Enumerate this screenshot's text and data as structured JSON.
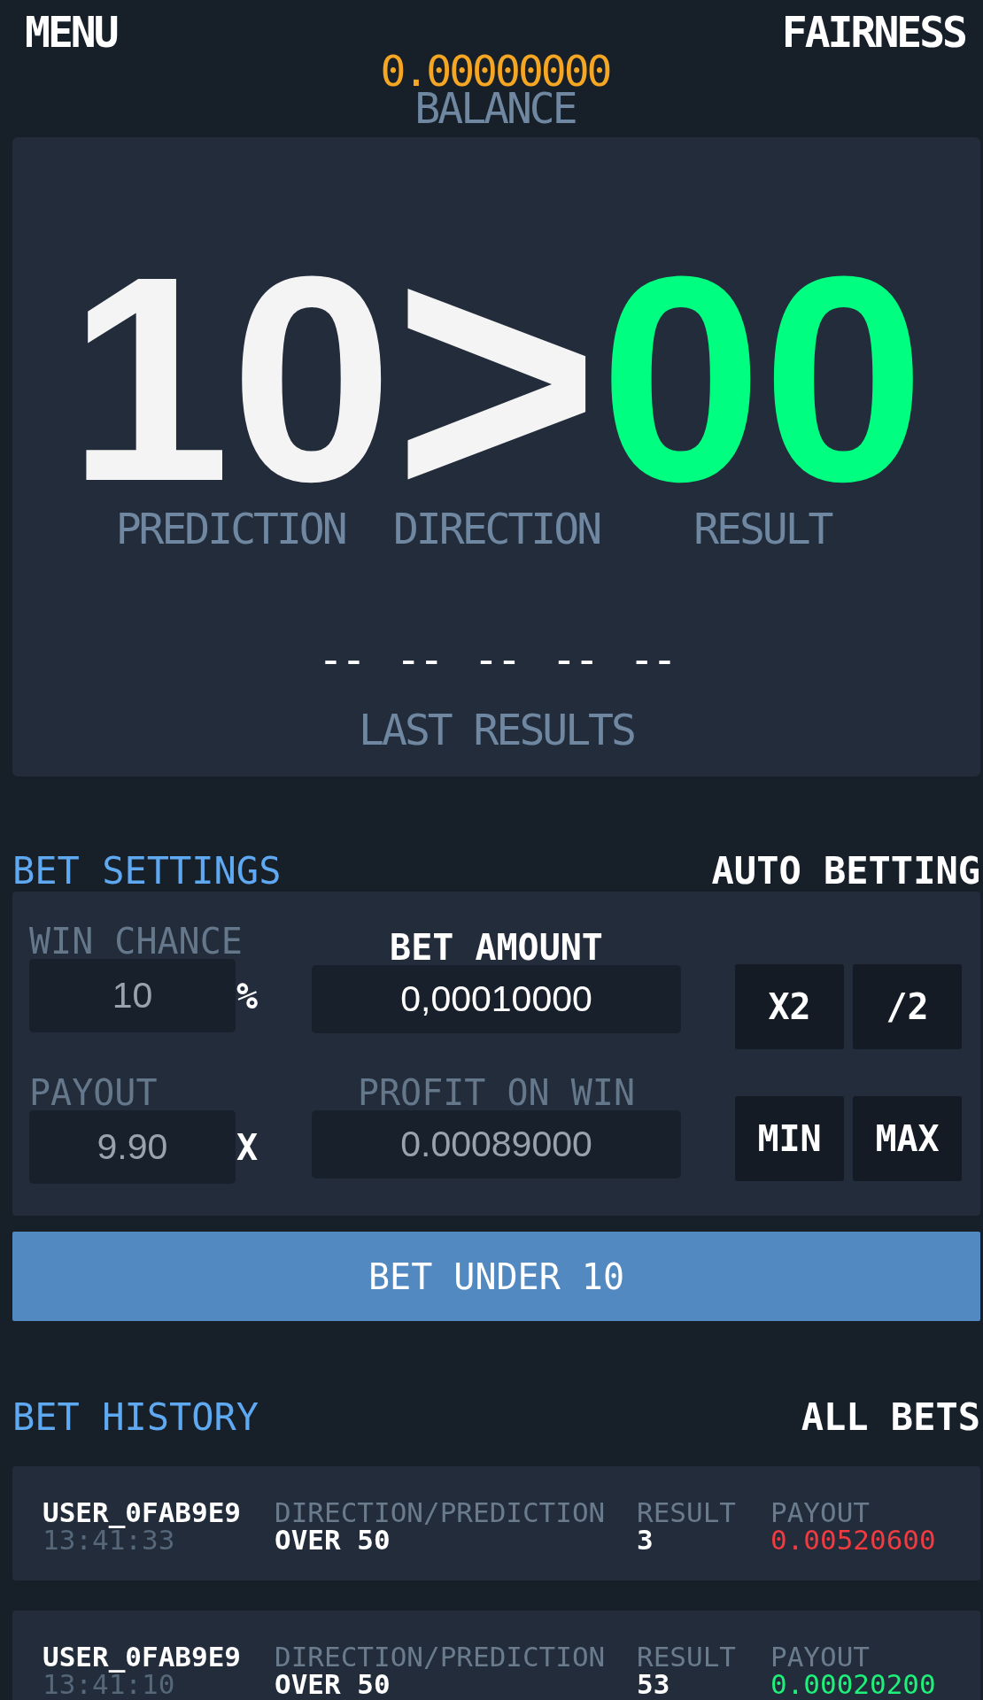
{
  "header": {
    "menu": "MENU",
    "fairness": "FAIRNESS",
    "balance": {
      "value": "0.00000000",
      "label": "BALANCE"
    }
  },
  "display": {
    "readouts": [
      {
        "kind": "prediction",
        "value": "10",
        "label": "PREDICTION"
      },
      {
        "kind": "direction",
        "value": ">",
        "label": "DIRECTION"
      },
      {
        "kind": "result",
        "value": "00",
        "label": "RESULT"
      }
    ],
    "last_results": {
      "values": [
        "--",
        "--",
        "--",
        "--",
        "--"
      ],
      "label": "LAST RESULTS"
    }
  },
  "bet_settings": {
    "tabs": [
      {
        "label": "BET SETTINGS",
        "selected": true
      },
      {
        "label": "AUTO BETTING",
        "selected": false
      }
    ],
    "rows": [
      {
        "fields": [
          {
            "label": "WIN CHANCE",
            "value": "10",
            "unit": "%",
            "focused": false
          },
          {
            "label": "BET AMOUNT",
            "value": "0,00010000",
            "focused": true
          }
        ],
        "buttons": [
          "X2",
          "/2"
        ]
      },
      {
        "fields": [
          {
            "label": "PAYOUT",
            "value": "9.90",
            "unit": "X",
            "focused": false
          },
          {
            "label": "PROFIT ON WIN",
            "value": "0.00089000",
            "focused": false
          }
        ],
        "buttons": [
          "MIN",
          "MAX"
        ]
      }
    ]
  },
  "bet_button": {
    "label": "BET UNDER 10"
  },
  "bet_history": {
    "tabs": [
      {
        "label": "BET HISTORY",
        "selected": true
      },
      {
        "label": "ALL BETS",
        "selected": false
      }
    ],
    "rows": [
      {
        "user": "USER_0FAB9E9",
        "time": "13:41:33",
        "direction_label": "DIRECTION/PREDICTION",
        "direction": "OVER 50",
        "result_label": "RESULT",
        "result": "3",
        "payout_label": "PAYOUT",
        "payout": "0.00520600",
        "color": "#f03b40"
      },
      {
        "user": "USER_0FAB9E9",
        "time": "13:41:10",
        "direction_label": "DIRECTION/PREDICTION",
        "direction": "OVER 50",
        "result_label": "RESULT",
        "result": "53",
        "payout_label": "PAYOUT",
        "payout": "0.00020200",
        "color": "#1ff07a"
      }
    ]
  }
}
